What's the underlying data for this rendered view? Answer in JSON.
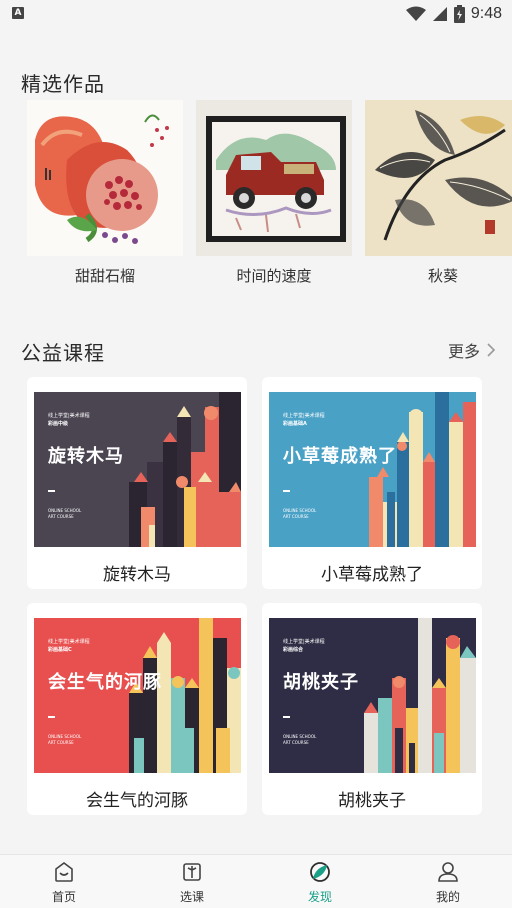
{
  "status_bar": {
    "time": "9:48",
    "left_badge": "A"
  },
  "featured": {
    "title": "精选作品",
    "items": [
      {
        "caption": "甜甜石榴"
      },
      {
        "caption": "时间的速度"
      },
      {
        "caption": "秋葵"
      }
    ]
  },
  "courses": {
    "title": "公益课程",
    "more_label": "更多",
    "items": [
      {
        "poster_title": "旋转木马",
        "poster_sub1": "线上学堂|美术课程",
        "poster_sub2": "彩画中级",
        "poster_foot1": "ONLINE SCHOOL",
        "poster_foot2": "ART COURSE",
        "caption": "旋转木马"
      },
      {
        "poster_title": "小草莓成熟了",
        "poster_sub1": "线上学堂|美术课程",
        "poster_sub2": "彩画基础A",
        "poster_foot1": "ONLINE SCHOOL",
        "poster_foot2": "ART COURSE",
        "caption": "小草莓成熟了"
      },
      {
        "poster_title": "会生气的河豚",
        "poster_sub1": "线上学堂|美术课程",
        "poster_sub2": "彩画基础C",
        "poster_foot1": "ONLINE SCHOOL",
        "poster_foot2": "ART COURSE",
        "caption": "会生气的河豚"
      },
      {
        "poster_title": "胡桃夹子",
        "poster_sub1": "线上学堂|美术课程",
        "poster_sub2": "彩画综合",
        "poster_foot1": "ONLINE SCHOOL",
        "poster_foot2": "ART COURSE",
        "caption": "胡桃夹子"
      }
    ]
  },
  "nav": {
    "items": [
      {
        "label": "首页",
        "icon": "home-icon"
      },
      {
        "label": "选课",
        "icon": "book-icon"
      },
      {
        "label": "发现",
        "icon": "discover-icon",
        "active": true
      },
      {
        "label": "我的",
        "icon": "profile-icon"
      }
    ],
    "active_color": "#19a087"
  }
}
